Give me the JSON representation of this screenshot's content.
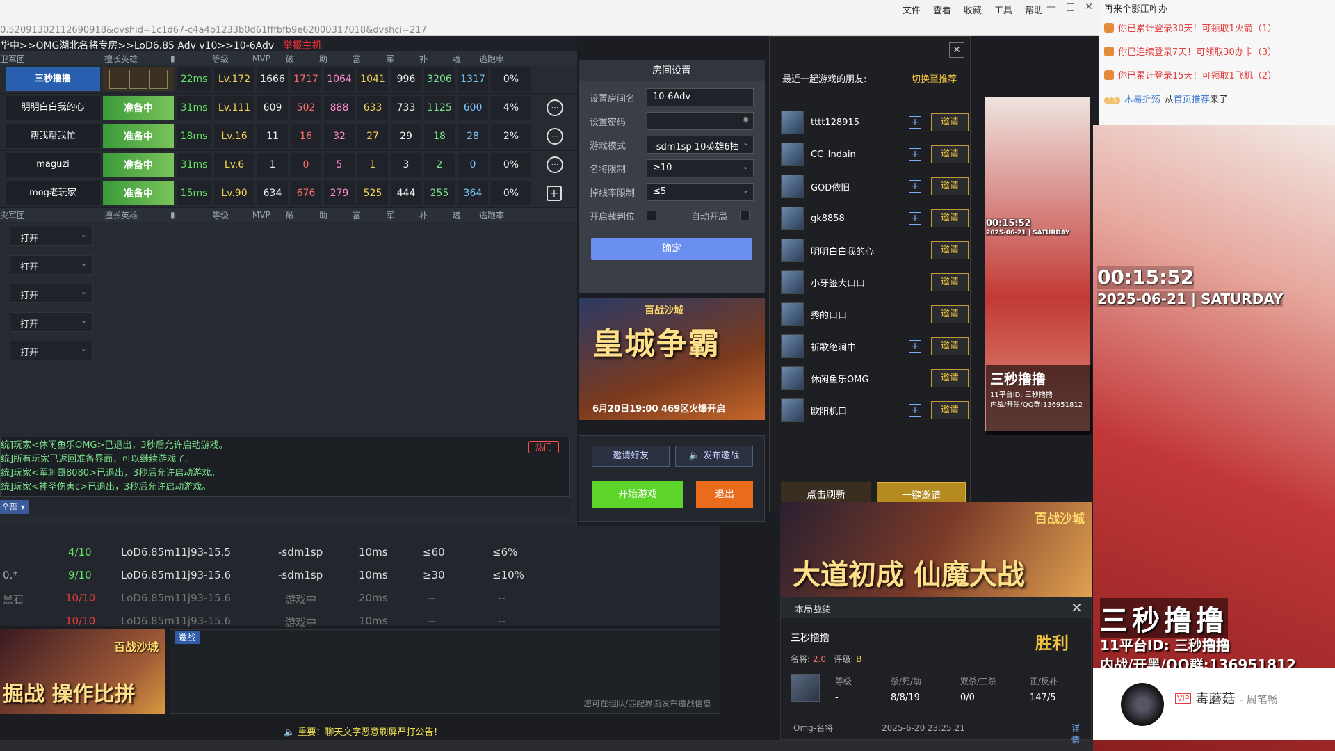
{
  "browser": {
    "menu": [
      "文件",
      "查看",
      "收藏",
      "工具",
      "帮助"
    ],
    "url": "0.52091302112690918&dvshid=1c1d67-c4a4b1233b0d61fffbfb9e62000317018&dvshci=217"
  },
  "game": {
    "breadcrumb": "华中>>OMG湖北名将专房>>LoD6.85 Adv v10>>10-6Adv",
    "host_tag": "举报主机",
    "team1": "卫军团",
    "team2": "灾军团",
    "columns": [
      "擅长英雄",
      "等级",
      "MVP",
      "破",
      "助",
      "富",
      "军",
      "补",
      "魂",
      "逃跑率"
    ],
    "players": [
      {
        "name": "三秒撸撸",
        "ping": "22ms",
        "level": "Lv.172",
        "mvp": "1666",
        "po": "1717",
        "zhu": "1064",
        "fu": "1041",
        "jun": "996",
        "bu": "3206",
        "hun": "1317",
        "escape": "0%"
      },
      {
        "name": "明明白白我的心",
        "hero": "准备中",
        "ping": "31ms",
        "level": "Lv.111",
        "mvp": "609",
        "po": "502",
        "zhu": "888",
        "fu": "633",
        "jun": "733",
        "bu": "1125",
        "hun": "600",
        "escape": "4%"
      },
      {
        "name": "帮我帮我忙",
        "hero": "准备中",
        "ping": "18ms",
        "level": "Lv.16",
        "mvp": "11",
        "po": "16",
        "zhu": "32",
        "fu": "27",
        "jun": "29",
        "bu": "18",
        "hun": "28",
        "escape": "2%"
      },
      {
        "name": "maguzi",
        "hero": "准备中",
        "ping": "31ms",
        "level": "Lv.6",
        "mvp": "1",
        "po": "0",
        "zhu": "5",
        "fu": "1",
        "jun": "3",
        "bu": "2",
        "hun": "0",
        "escape": "0%"
      },
      {
        "name": "mog老玩家",
        "hero": "准备中",
        "ping": "15ms",
        "level": "Lv.90",
        "mvp": "634",
        "po": "676",
        "zhu": "279",
        "fu": "525",
        "jun": "444",
        "bu": "255",
        "hun": "364",
        "escape": "0%"
      }
    ],
    "open_slots": [
      "打开",
      "打开",
      "打开",
      "打开",
      "打开"
    ]
  },
  "settings": {
    "title": "房间设置",
    "room_name_label": "设置房间名",
    "room_name": "10-6Adv",
    "password_label": "设置密码",
    "mode_label": "游戏模式",
    "mode": "-sdm1sp 10英雄6抽",
    "fame_label": "名将限制",
    "fame": "≥10",
    "drop_label": "掉线率限制",
    "drop": "≤5",
    "judge_label": "开启裁判位",
    "auto_label": "自动开局",
    "confirm": "确定"
  },
  "banner": {
    "title": "皇城争霸",
    "logo": "百战沙城",
    "sub": "6月20日19:00  469区火爆开启"
  },
  "friends": {
    "header": "最近一起游戏的朋友:",
    "switch": "切换至推荐",
    "list": [
      {
        "name": "tttt128915",
        "add": true,
        "invite": "邀请"
      },
      {
        "name": "CC_Indain",
        "add": true,
        "invite": "邀请"
      },
      {
        "name": "GOD依旧",
        "add": true,
        "invite": "邀请"
      },
      {
        "name": "gk8858",
        "add": true,
        "invite": "邀请"
      },
      {
        "name": "明明白白我的心",
        "add": false,
        "invite": "邀请"
      },
      {
        "name": "小牙签大口口",
        "add": false,
        "invite": "邀请"
      },
      {
        "name": "秀的口口",
        "add": false,
        "invite": "邀请"
      },
      {
        "name": "祈歌绝涧中",
        "add": true,
        "invite": "邀请"
      },
      {
        "name": "休闲鱼乐OMG",
        "add": false,
        "invite": "邀请"
      },
      {
        "name": "欧阳机口",
        "add": true,
        "invite": "邀请"
      }
    ],
    "refresh": "点击刷新",
    "invite_all": "一键邀请"
  },
  "chat": {
    "lines": [
      "统]玩家<休闲鱼乐OMG>已退出，3秒后允许启动游戏。",
      "统]所有玩家已返回准备界面，可以继续游戏了。",
      "统]玩家<军刺哥8080>已退出，3秒后允许启动游戏。",
      "统]玩家<神圣伤害c>已退出，3秒后允许启动游戏。"
    ],
    "hot": "热门",
    "filter": "全部"
  },
  "actions": {
    "invite_friends": "邀请好友",
    "publish": "发布邀战",
    "start": "开始游戏",
    "quit": "退出"
  },
  "rooms": [
    {
      "count": "4/10",
      "map": "LoD6.85m11j93-15.5",
      "mode": "-sdm1sp",
      "ping": "10ms",
      "fame": "≤60",
      "drop": "≤6%",
      "prefix": ""
    },
    {
      "count": "9/10",
      "map": "LoD6.85m11j93-15.6",
      "mode": "-sdm1sp",
      "ping": "10ms",
      "fame": "≥30",
      "drop": "≤10%",
      "prefix": "0.*"
    },
    {
      "count": "10/10",
      "map": "LoD6.85m11j93-15.6",
      "mode": "游戏中",
      "ping": "20ms",
      "fame": "--",
      "drop": "--",
      "prefix": "黑石"
    },
    {
      "count": "10/10",
      "map": "LoD6.85m11j93-15.6",
      "mode": "游戏中",
      "ping": "10ms",
      "fame": "--",
      "drop": "--",
      "prefix": ""
    }
  ],
  "ad2": {
    "title": "掘战 操作比拼",
    "logo": "百战沙城"
  },
  "yaozhan": {
    "tag": "邀战",
    "hint": "您可在组队/匹配界面发布邀战信息"
  },
  "notice": "重要：聊天文字恶意刷屏严打公告！",
  "ad3": {
    "title": "大道初成 仙魔大战",
    "logo": "百战沙城"
  },
  "result": {
    "title": "本局战绩",
    "player": "三秒撸撸",
    "outcome": "胜利",
    "fame_label": "名将:",
    "fame": "2.0",
    "grade_label": "评级:",
    "grade": "B",
    "cols": [
      {
        "label": "等级",
        "value": "-"
      },
      {
        "label": "杀/死/助",
        "value": "8/8/19"
      },
      {
        "label": "双杀/三杀",
        "value": "0/0"
      },
      {
        "label": "正/反补",
        "value": "147/5"
      }
    ],
    "room": "Omg-名将",
    "date": "2025-6-20 23:25:21",
    "detail": "详情"
  },
  "stream": {
    "panel_title": "再来个影压咋办",
    "notices": [
      "你已累计登录30天！可领取1火箭（1）",
      "你已连续登录7天！可领取30办卡（3）",
      "你已累计登录15天！可领取1飞机（2）"
    ],
    "visitor_level": "13",
    "visitor": "木易折殇",
    "visitor_from": "从",
    "visitor_source": "首页推荐",
    "visitor_suffix": "来了",
    "time": "00:15:52",
    "date": "2025-06-21 | SATURDAY",
    "brand": "三秒撸撸",
    "room_id": "11平台ID: 三秒撸撸",
    "qq": "内战/开黑/QQ群:136951812",
    "anchor_vip": "VIP",
    "anchor": "毒蘑菇",
    "anchor_sub": "- 周笔畅"
  }
}
